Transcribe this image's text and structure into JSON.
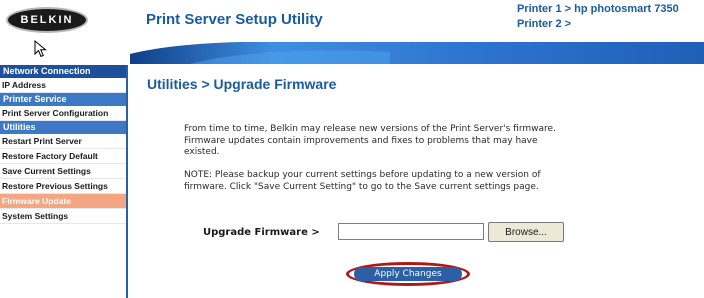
{
  "header": {
    "brand": "BELKIN",
    "title": "Print Server Setup Utility",
    "printers": [
      "Printer 1 > hp photosmart 7350",
      "Printer 2 >"
    ]
  },
  "sidebar": {
    "network_heading": "Network Connection",
    "network_items": [
      "IP Address"
    ],
    "printer_heading": "Printer Service",
    "printer_items": [
      "Print Server Configuration"
    ],
    "utilities_heading": "Utilities",
    "utility_items": [
      "Restart Print Server",
      "Restore Factory Default",
      "Save Current Settings",
      "Restore Previous Settings",
      "Firmware Update"
    ],
    "extra_items": [
      "System Settings"
    ]
  },
  "main": {
    "title": "Utilities > Upgrade Firmware",
    "para1": "From time to time, Belkin may release new versions of the Print Server's firmware. Firmware updates contain improvements and fixes to problems that may have existed.",
    "para2": "NOTE: Please backup your current settings before updating to a new version of firmware. Click \"Save Current Setting\" to go to the Save current settings page.",
    "upgrade_label": "Upgrade Firmware >",
    "upgrade_value": "",
    "browse_label": "Browse...",
    "apply_label": "Apply Changes"
  },
  "colors": {
    "brand_blue": "#1a5b9f",
    "sidebar_dark": "#1c4f9c",
    "sidebar_mid": "#3d78c5",
    "active_item": "#f4a582",
    "highlight_ring": "#b01818"
  },
  "icons": {
    "cursor": "arrow-cursor-icon"
  }
}
